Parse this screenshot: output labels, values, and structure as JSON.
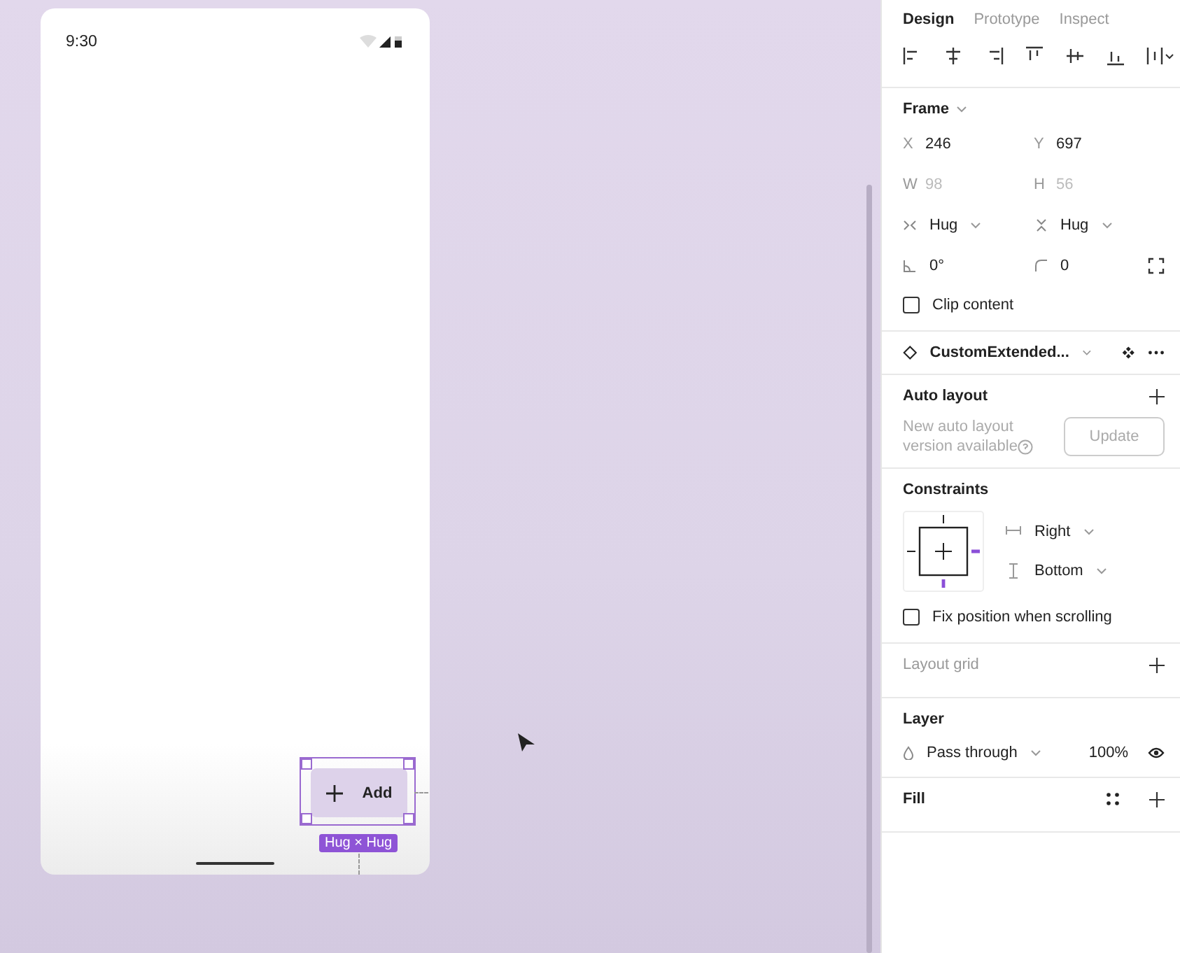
{
  "canvas": {
    "frame": {
      "time": "9:30"
    },
    "fab": {
      "label": "Add",
      "selected": true
    },
    "size_badge": "Hug × Hug"
  },
  "panel": {
    "tabs": [
      {
        "label": "Design",
        "selected": true
      },
      {
        "label": "Prototype",
        "selected": false
      },
      {
        "label": "Inspect",
        "selected": false
      }
    ],
    "frame": {
      "title": "Frame",
      "position": [
        {
          "label": "X",
          "value": "246",
          "disabled": false
        },
        {
          "label": "Y",
          "value": "697",
          "disabled": false
        }
      ],
      "size": [
        {
          "label": "W",
          "value": "98",
          "disabled": true
        },
        {
          "label": "H",
          "value": "56",
          "disabled": true
        }
      ],
      "resizing": [
        "Hug",
        "Hug"
      ],
      "rotation": "0°",
      "corner_radius": "0",
      "clip_content": {
        "label": "Clip content",
        "checked": false
      }
    },
    "component": {
      "name": "CustomExtended..."
    },
    "auto_layout": {
      "title": "Auto layout",
      "notice": "New auto layout version available",
      "button": "Update"
    },
    "constraints": {
      "title": "Constraints",
      "horizontal": "Right",
      "vertical": "Bottom",
      "fix_position": {
        "label": "Fix position when scrolling",
        "checked": false
      }
    },
    "layout_grid": {
      "title": "Layout grid"
    },
    "layer": {
      "title": "Layer",
      "blend": "Pass through",
      "opacity": "100%"
    },
    "fill": {
      "title": "Fill"
    }
  }
}
